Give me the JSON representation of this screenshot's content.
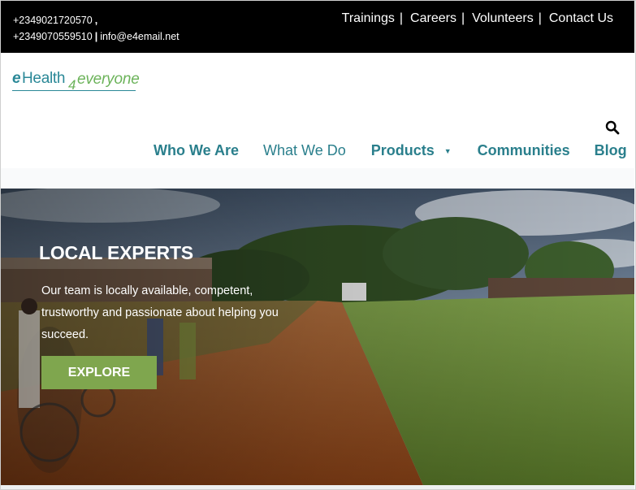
{
  "topbar": {
    "phone1": "+2349021720570",
    "comma": ",",
    "phone2": "+2349070559510",
    "separator": "|",
    "email": "info@e4email.net",
    "links": [
      "Trainings",
      "Careers",
      "Volunteers",
      "Contact Us"
    ],
    "link_separator": "|"
  },
  "logo": {
    "part1": "e",
    "part2": "Health",
    "part3": "4",
    "part4": "everyone"
  },
  "nav": {
    "items": [
      "Who We Are",
      "What We Do",
      "Products",
      "Communities",
      "Blog"
    ],
    "products_caret": "▼"
  },
  "hero": {
    "title": "LOCAL EXPERTS",
    "text": "Our team is locally available, competent, trustworthy and passionate about helping you succeed.",
    "button_label": "EXPLORE"
  },
  "colors": {
    "brand_teal": "#2a7f8c",
    "brand_green": "#7fa64e",
    "topbar_bg": "#000000"
  },
  "icons": {
    "search": "search-icon",
    "caret": "caret-down-icon"
  }
}
